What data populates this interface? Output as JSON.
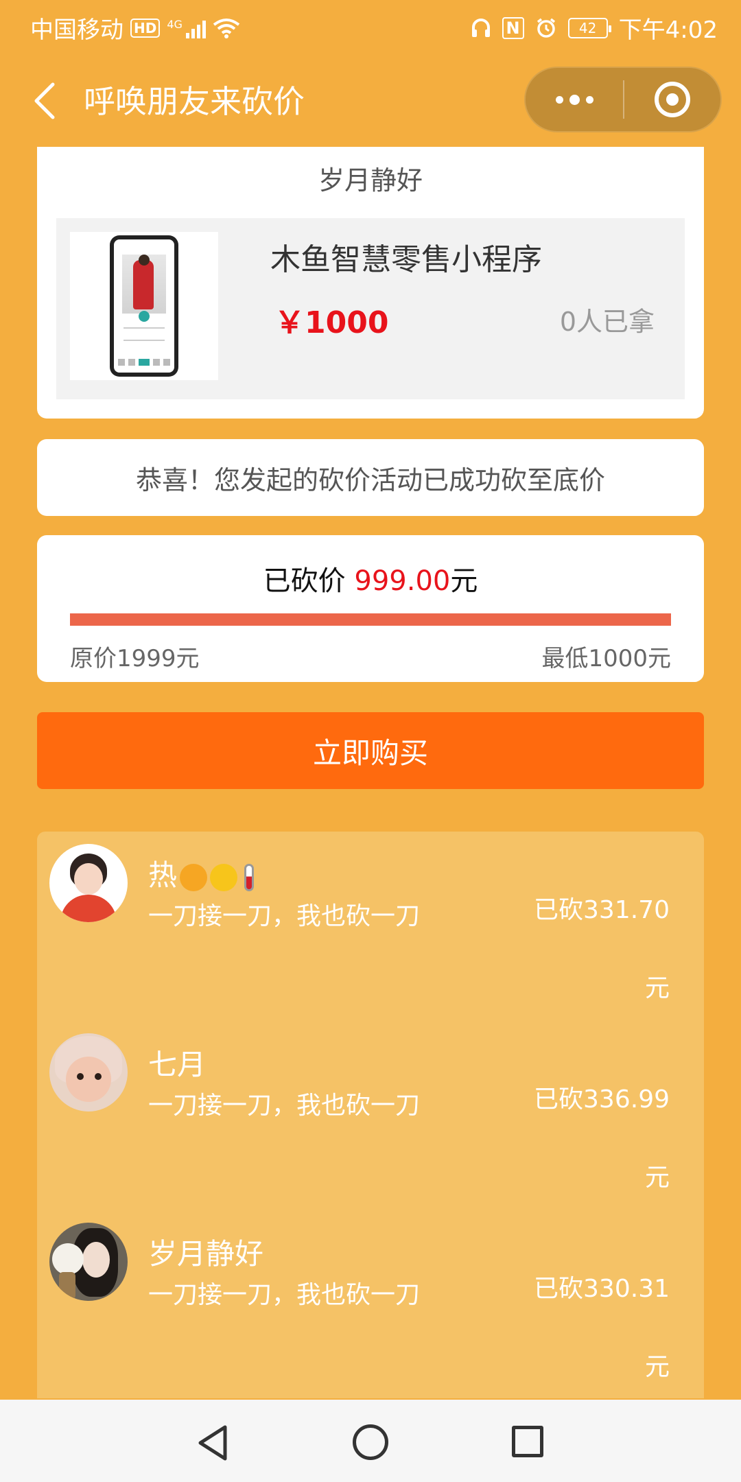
{
  "status_bar": {
    "carrier": "中国移动",
    "hd": "HD",
    "network": "4G",
    "nfc": "N",
    "battery": "42",
    "time": "下午4:02"
  },
  "nav": {
    "title": "呼唤朋友来砍价"
  },
  "product_card": {
    "owner_name": "岁月静好",
    "product_name": "木鱼智慧零售小程序",
    "price": "￥1000",
    "taken_count": "0人已拿"
  },
  "success_message": "恭喜！您发起的砍价活动已成功砍至底价",
  "progress": {
    "cut_label": "已砍价",
    "cut_amount": "999.00",
    "cut_unit": "元",
    "original_price": "原价1999元",
    "min_price": "最低1000元",
    "fill_fraction": 1.0
  },
  "buy_button": "立即购买",
  "helpers": [
    {
      "name": "热",
      "comment": "一刀接一刀，我也砍一刀",
      "amount": "已砍331.70元"
    },
    {
      "name": "七月",
      "comment": "一刀接一刀，我也砍一刀",
      "amount": "已砍336.99元"
    },
    {
      "name": "岁月静好",
      "comment": "一刀接一刀，我也砍一刀",
      "amount": "已砍330.31元"
    }
  ],
  "icons": {
    "back": "chevron-left-icon",
    "more": "more-dots-icon",
    "close": "target-close-icon"
  },
  "colors": {
    "background": "#f4ae3f",
    "buy_button": "#ff6a0e",
    "price_red": "#e8131b",
    "progress_fill": "#ec664a"
  }
}
